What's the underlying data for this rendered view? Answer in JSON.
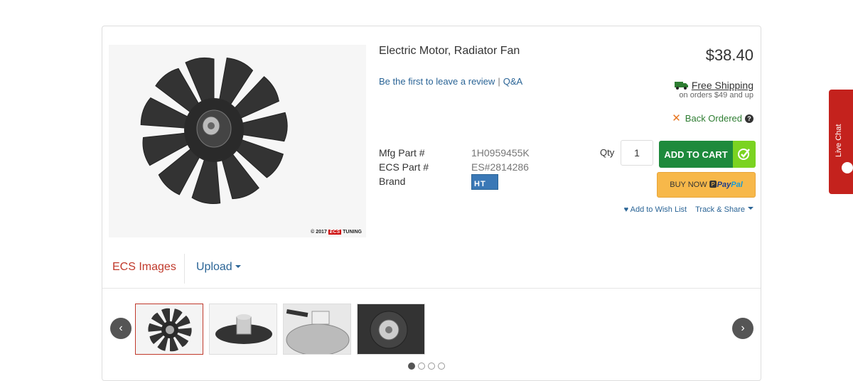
{
  "product": {
    "title": "Electric Motor, Radiator Fan",
    "price": "$38.40",
    "review_link": "Be the first to leave a review",
    "qa_link": "Q&A",
    "separator": "|"
  },
  "specs": [
    {
      "label": "Mfg Part #",
      "value": "1H0959455K"
    },
    {
      "label": "ECS Part #",
      "value": "ES#2814286"
    },
    {
      "label": "Brand",
      "value": ""
    }
  ],
  "brand_logo_text": "HT",
  "shipping": {
    "title": "Free Shipping",
    "subtitle": "on orders $49 and up"
  },
  "stock": {
    "status": "Back Ordered",
    "help": "?"
  },
  "purchase": {
    "qty_label": "Qty",
    "qty_value": "1",
    "add_to_cart": "ADD TO CART",
    "buy_now": "BUY NOW",
    "paypal_1": "Pay",
    "paypal_2": "Pal"
  },
  "actions": {
    "wishlist": "Add to Wish List",
    "track_share": "Track & Share"
  },
  "image_watermark": {
    "year": "© 2017",
    "brand": "ECS",
    "suffix": "TUNING"
  },
  "tabs": {
    "ecs_images": "ECS Images",
    "upload": "Upload"
  },
  "carousel": {
    "prev": "‹",
    "next": "›",
    "thumbnails": [
      "fan-front",
      "fan-side",
      "fan-motor-closeup",
      "fan-hub-closeup"
    ],
    "pages": 4,
    "active_page": 1
  },
  "live_chat": "Live Chat",
  "colors": {
    "accent_red": "#c0392b",
    "link_blue": "#2a6496",
    "cart_green": "#1e8a3c",
    "paypal_yellow": "#f7b84a",
    "live_chat_red": "#c4221d"
  }
}
